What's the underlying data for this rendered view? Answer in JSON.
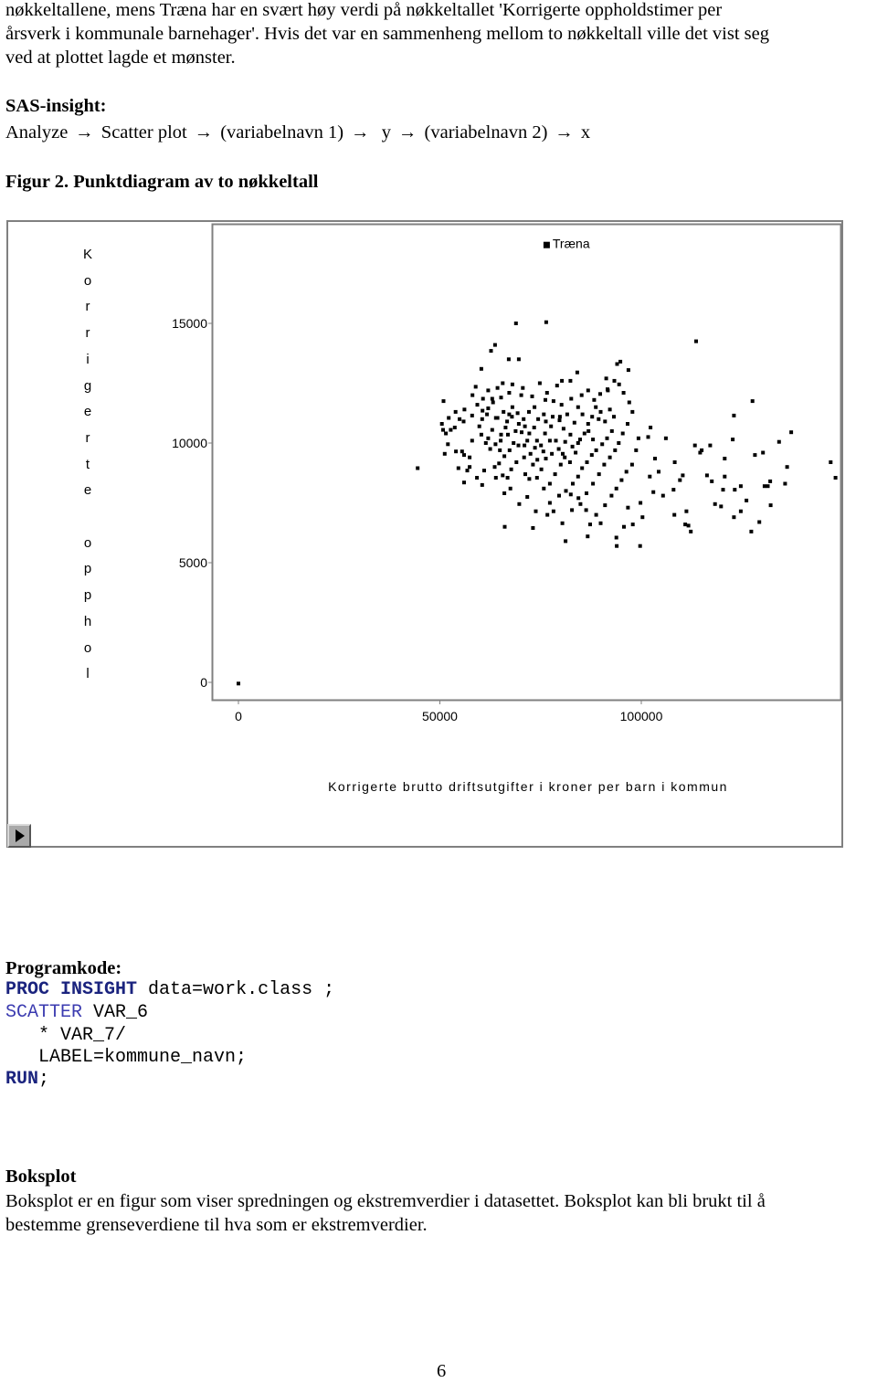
{
  "intro": {
    "lines": [
      "nøkkeltallene, mens Træna har en svært høy verdi på nøkkeltallet 'Korrigerte oppholdstimer per",
      "årsverk i kommunale barnehager'. Hvis det var en sammenheng mellom to nøkkeltall ville det vist seg",
      "ved at plottet lagde et mønster."
    ]
  },
  "sas_insight": {
    "heading": "SAS-insight:",
    "path": [
      "Analyze",
      "Scatter plot",
      "(variabelnavn 1)",
      "y",
      "(variabelnavn 2)",
      "x"
    ],
    "arrow": "→"
  },
  "figure": {
    "caption": "Figur 2. Punktdiagram av to nøkkeltall"
  },
  "chart_data": {
    "type": "scatter",
    "title": "",
    "xlabel": "Korrigerte brutto driftsutgifter i kroner per barn i kommun",
    "ylabel": "Korrigerte opphol",
    "xticks": [
      "0",
      "50000",
      "100000"
    ],
    "xtick_values": [
      0,
      50000,
      100000
    ],
    "yticks": [
      "0",
      "5000",
      "10000",
      "15000"
    ],
    "ytick_values": [
      0,
      5000,
      10000,
      15000
    ],
    "xlim": [
      -4000,
      143000
    ],
    "ylim": [
      -800,
      16800
    ],
    "grid": false,
    "legend": null,
    "annotations": [
      {
        "label": "Træna",
        "x": 76400,
        "y": 15050
      }
    ],
    "marker": "square",
    "color": "#000000",
    "points": [
      [
        0,
        -50
      ],
      [
        44500,
        8950
      ],
      [
        50500,
        10800
      ],
      [
        50900,
        11750
      ],
      [
        52700,
        10550
      ],
      [
        53700,
        10650
      ],
      [
        55900,
        10900
      ],
      [
        54900,
        11000
      ],
      [
        53900,
        11300
      ],
      [
        52200,
        11050
      ],
      [
        51500,
        10400
      ],
      [
        52000,
        9950
      ],
      [
        50800,
        10550
      ],
      [
        51200,
        9550
      ],
      [
        54000,
        9650
      ],
      [
        55500,
        9650
      ],
      [
        56000,
        9500
      ],
      [
        57400,
        9400
      ],
      [
        54600,
        8950
      ],
      [
        57400,
        9000
      ],
      [
        56000,
        8350
      ],
      [
        59200,
        8550
      ],
      [
        56800,
        8850
      ],
      [
        58000,
        10100
      ],
      [
        59800,
        10700
      ],
      [
        60300,
        10350
      ],
      [
        62000,
        10200
      ],
      [
        60500,
        11000
      ],
      [
        58000,
        11150
      ],
      [
        61700,
        11200
      ],
      [
        59300,
        11600
      ],
      [
        60600,
        11350
      ],
      [
        62000,
        11450
      ],
      [
        63200,
        11700
      ],
      [
        62000,
        12200
      ],
      [
        64300,
        12300
      ],
      [
        62700,
        13850
      ],
      [
        60300,
        13100
      ],
      [
        63700,
        14100
      ],
      [
        68900,
        15000
      ],
      [
        67100,
        13500
      ],
      [
        69600,
        13500
      ],
      [
        58100,
        12000
      ],
      [
        65200,
        11900
      ],
      [
        65800,
        11300
      ],
      [
        64300,
        11050
      ],
      [
        66300,
        10650
      ],
      [
        66700,
        10900
      ],
      [
        67900,
        11100
      ],
      [
        68000,
        11500
      ],
      [
        69300,
        11250
      ],
      [
        70800,
        11000
      ],
      [
        71100,
        10700
      ],
      [
        72200,
        10400
      ],
      [
        71700,
        10100
      ],
      [
        73400,
        10650
      ],
      [
        74400,
        11000
      ],
      [
        75800,
        11200
      ],
      [
        73500,
        11500
      ],
      [
        72100,
        11300
      ],
      [
        70200,
        12000
      ],
      [
        67200,
        12100
      ],
      [
        68000,
        12450
      ],
      [
        65600,
        12500
      ],
      [
        63900,
        11050
      ],
      [
        63000,
        10550
      ],
      [
        61400,
        10000
      ],
      [
        62500,
        9750
      ],
      [
        63800,
        9950
      ],
      [
        65100,
        10100
      ],
      [
        64900,
        9700
      ],
      [
        66000,
        9450
      ],
      [
        67300,
        9700
      ],
      [
        68300,
        10000
      ],
      [
        69500,
        9900
      ],
      [
        71000,
        9900
      ],
      [
        70900,
        9400
      ],
      [
        69000,
        9200
      ],
      [
        67700,
        8900
      ],
      [
        66800,
        8550
      ],
      [
        63900,
        8550
      ],
      [
        63600,
        9000
      ],
      [
        64700,
        9150
      ],
      [
        65600,
        8650
      ],
      [
        67500,
        8100
      ],
      [
        66000,
        7900
      ],
      [
        61000,
        8850
      ],
      [
        60500,
        8250
      ],
      [
        69700,
        7450
      ],
      [
        71200,
        8700
      ],
      [
        72200,
        8500
      ],
      [
        73100,
        9100
      ],
      [
        74200,
        9300
      ],
      [
        73600,
        9800
      ],
      [
        75100,
        9900
      ],
      [
        76100,
        10400
      ],
      [
        77600,
        10700
      ],
      [
        76300,
        10900
      ],
      [
        78000,
        11100
      ],
      [
        79700,
        10950
      ],
      [
        80700,
        10600
      ],
      [
        81600,
        11200
      ],
      [
        80200,
        11600
      ],
      [
        78200,
        11750
      ],
      [
        76200,
        11800
      ],
      [
        79100,
        12400
      ],
      [
        80300,
        12600
      ],
      [
        82400,
        12600
      ],
      [
        84100,
        12950
      ],
      [
        82600,
        11850
      ],
      [
        84300,
        11500
      ],
      [
        85400,
        11200
      ],
      [
        83400,
        10850
      ],
      [
        82400,
        10350
      ],
      [
        81100,
        10050
      ],
      [
        79500,
        9750
      ],
      [
        77800,
        9550
      ],
      [
        76300,
        9350
      ],
      [
        75200,
        8900
      ],
      [
        74100,
        8550
      ],
      [
        75800,
        8100
      ],
      [
        77300,
        8300
      ],
      [
        78600,
        8700
      ],
      [
        80000,
        9100
      ],
      [
        81000,
        9400
      ],
      [
        82300,
        9200
      ],
      [
        83700,
        9600
      ],
      [
        84300,
        10000
      ],
      [
        85900,
        10400
      ],
      [
        86800,
        10800
      ],
      [
        87800,
        11100
      ],
      [
        88700,
        11500
      ],
      [
        89900,
        11300
      ],
      [
        91000,
        10900
      ],
      [
        92200,
        11400
      ],
      [
        93200,
        11100
      ],
      [
        92700,
        10500
      ],
      [
        91500,
        10200
      ],
      [
        90300,
        9950
      ],
      [
        88800,
        9700
      ],
      [
        87700,
        9500
      ],
      [
        86500,
        9200
      ],
      [
        85300,
        8950
      ],
      [
        84300,
        8600
      ],
      [
        83000,
        8300
      ],
      [
        81300,
        8000
      ],
      [
        79600,
        7800
      ],
      [
        77300,
        7500
      ],
      [
        76700,
        7000
      ],
      [
        78200,
        7150
      ],
      [
        80400,
        6650
      ],
      [
        82800,
        7200
      ],
      [
        84900,
        7450
      ],
      [
        86400,
        7900
      ],
      [
        88000,
        8300
      ],
      [
        89500,
        8700
      ],
      [
        90800,
        9100
      ],
      [
        92200,
        9400
      ],
      [
        93500,
        9700
      ],
      [
        94400,
        10000
      ],
      [
        95400,
        10400
      ],
      [
        96600,
        10800
      ],
      [
        97800,
        11300
      ],
      [
        97000,
        11700
      ],
      [
        95600,
        12100
      ],
      [
        94500,
        12450
      ],
      [
        93300,
        12600
      ],
      [
        91600,
        12250
      ],
      [
        89800,
        12050
      ],
      [
        88300,
        11800
      ],
      [
        86800,
        12200
      ],
      [
        85200,
        12000
      ],
      [
        91300,
        12700
      ],
      [
        94000,
        13300
      ],
      [
        96800,
        13050
      ],
      [
        94800,
        13400
      ],
      [
        99300,
        10200
      ],
      [
        98700,
        9700
      ],
      [
        97700,
        9100
      ],
      [
        96300,
        8800
      ],
      [
        95100,
        8450
      ],
      [
        93800,
        8100
      ],
      [
        92600,
        7800
      ],
      [
        91000,
        7400
      ],
      [
        88800,
        7000
      ],
      [
        87300,
        6600
      ],
      [
        86700,
        6100
      ],
      [
        89900,
        6650
      ],
      [
        93800,
        6050
      ],
      [
        93900,
        5700
      ],
      [
        95700,
        6500
      ],
      [
        97900,
        6600
      ],
      [
        100300,
        6900
      ],
      [
        103000,
        7950
      ],
      [
        99800,
        7500
      ],
      [
        102100,
        8600
      ],
      [
        104300,
        8800
      ],
      [
        103400,
        9350
      ],
      [
        101700,
        10250
      ],
      [
        102300,
        10650
      ],
      [
        106100,
        10200
      ],
      [
        108300,
        9200
      ],
      [
        110300,
        8650
      ],
      [
        113300,
        9900
      ],
      [
        115000,
        9700
      ],
      [
        111200,
        7150
      ],
      [
        110900,
        6600
      ],
      [
        111700,
        6550
      ],
      [
        112300,
        6300
      ],
      [
        108200,
        7000
      ],
      [
        105400,
        7800
      ],
      [
        108000,
        8050
      ],
      [
        109600,
        8450
      ],
      [
        114600,
        9600
      ],
      [
        117100,
        9900
      ],
      [
        120700,
        9350
      ],
      [
        122700,
        10150
      ],
      [
        120700,
        8600
      ],
      [
        120300,
        8050
      ],
      [
        116300,
        8650
      ],
      [
        117500,
        8400
      ],
      [
        123200,
        8050
      ],
      [
        118300,
        7450
      ],
      [
        119800,
        7350
      ],
      [
        124700,
        8200
      ],
      [
        124700,
        7150
      ],
      [
        130600,
        8200
      ],
      [
        131400,
        8200
      ],
      [
        126100,
        7600
      ],
      [
        129300,
        6700
      ],
      [
        123000,
        6900
      ],
      [
        127300,
        6300
      ],
      [
        132100,
        7400
      ],
      [
        130200,
        9600
      ],
      [
        134200,
        10050
      ],
      [
        137200,
        10450
      ],
      [
        136200,
        9000
      ],
      [
        127600,
        11750
      ],
      [
        113600,
        14250
      ],
      [
        147000,
        9200
      ],
      [
        148200,
        8550
      ],
      [
        135700,
        8300
      ],
      [
        132000,
        8400
      ],
      [
        128200,
        9500
      ],
      [
        123000,
        11150
      ],
      [
        72500,
        9550
      ],
      [
        70300,
        10450
      ],
      [
        66900,
        10350
      ],
      [
        72900,
        11950
      ],
      [
        74800,
        12500
      ],
      [
        70600,
        12300
      ],
      [
        56100,
        11400
      ],
      [
        58900,
        12350
      ],
      [
        65200,
        10350
      ],
      [
        86900,
        10500
      ],
      [
        88000,
        10150
      ],
      [
        84800,
        10150
      ],
      [
        82900,
        9850
      ],
      [
        80500,
        9550
      ],
      [
        78800,
        10100
      ],
      [
        77300,
        10100
      ],
      [
        75700,
        9650
      ],
      [
        74100,
        10100
      ],
      [
        68800,
        10500
      ],
      [
        69600,
        10800
      ],
      [
        67200,
        11200
      ],
      [
        63000,
        11850
      ],
      [
        60700,
        11850
      ],
      [
        84400,
        7700
      ],
      [
        86300,
        7200
      ],
      [
        99700,
        5700
      ],
      [
        91700,
        12200
      ],
      [
        89400,
        11000
      ],
      [
        76600,
        12100
      ],
      [
        79800,
        11100
      ],
      [
        71700,
        7750
      ],
      [
        73800,
        7150
      ],
      [
        96700,
        7300
      ],
      [
        73100,
        6450
      ],
      [
        81200,
        5900
      ],
      [
        82500,
        7850
      ],
      [
        66100,
        6500
      ]
    ]
  },
  "program": {
    "heading": "Programkode:",
    "line1_kw1": "PROC",
    "line1_kw2": "INSIGHT",
    "line1_rest": " data=work.class ;",
    "line2_kw": "SCATTER",
    "line2_rest": " VAR_6",
    "line3": "   * VAR_7/",
    "line4": "   LABEL=kommune_navn;",
    "line5_kw": "RUN",
    "line5_rest": ";"
  },
  "boksplot": {
    "heading": "Boksplot",
    "lines": [
      "Boksplot er en figur som viser spredningen og ekstremverdier i datasettet. Boksplot kan bli brukt til å",
      "bestemme grenseverdiene til hva som er ekstremverdier."
    ]
  },
  "page_number": "6"
}
